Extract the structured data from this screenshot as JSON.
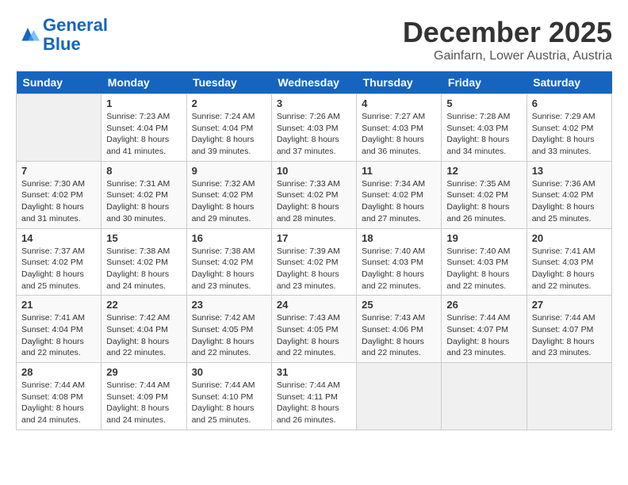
{
  "header": {
    "logo_line1": "General",
    "logo_line2": "Blue",
    "month_title": "December 2025",
    "location": "Gainfarn, Lower Austria, Austria"
  },
  "weekdays": [
    "Sunday",
    "Monday",
    "Tuesday",
    "Wednesday",
    "Thursday",
    "Friday",
    "Saturday"
  ],
  "weeks": [
    [
      {
        "day": "",
        "info": ""
      },
      {
        "day": "1",
        "info": "Sunrise: 7:23 AM\nSunset: 4:04 PM\nDaylight: 8 hours\nand 41 minutes."
      },
      {
        "day": "2",
        "info": "Sunrise: 7:24 AM\nSunset: 4:04 PM\nDaylight: 8 hours\nand 39 minutes."
      },
      {
        "day": "3",
        "info": "Sunrise: 7:26 AM\nSunset: 4:03 PM\nDaylight: 8 hours\nand 37 minutes."
      },
      {
        "day": "4",
        "info": "Sunrise: 7:27 AM\nSunset: 4:03 PM\nDaylight: 8 hours\nand 36 minutes."
      },
      {
        "day": "5",
        "info": "Sunrise: 7:28 AM\nSunset: 4:03 PM\nDaylight: 8 hours\nand 34 minutes."
      },
      {
        "day": "6",
        "info": "Sunrise: 7:29 AM\nSunset: 4:02 PM\nDaylight: 8 hours\nand 33 minutes."
      }
    ],
    [
      {
        "day": "7",
        "info": "Sunrise: 7:30 AM\nSunset: 4:02 PM\nDaylight: 8 hours\nand 31 minutes."
      },
      {
        "day": "8",
        "info": "Sunrise: 7:31 AM\nSunset: 4:02 PM\nDaylight: 8 hours\nand 30 minutes."
      },
      {
        "day": "9",
        "info": "Sunrise: 7:32 AM\nSunset: 4:02 PM\nDaylight: 8 hours\nand 29 minutes."
      },
      {
        "day": "10",
        "info": "Sunrise: 7:33 AM\nSunset: 4:02 PM\nDaylight: 8 hours\nand 28 minutes."
      },
      {
        "day": "11",
        "info": "Sunrise: 7:34 AM\nSunset: 4:02 PM\nDaylight: 8 hours\nand 27 minutes."
      },
      {
        "day": "12",
        "info": "Sunrise: 7:35 AM\nSunset: 4:02 PM\nDaylight: 8 hours\nand 26 minutes."
      },
      {
        "day": "13",
        "info": "Sunrise: 7:36 AM\nSunset: 4:02 PM\nDaylight: 8 hours\nand 25 minutes."
      }
    ],
    [
      {
        "day": "14",
        "info": "Sunrise: 7:37 AM\nSunset: 4:02 PM\nDaylight: 8 hours\nand 25 minutes."
      },
      {
        "day": "15",
        "info": "Sunrise: 7:38 AM\nSunset: 4:02 PM\nDaylight: 8 hours\nand 24 minutes."
      },
      {
        "day": "16",
        "info": "Sunrise: 7:38 AM\nSunset: 4:02 PM\nDaylight: 8 hours\nand 23 minutes."
      },
      {
        "day": "17",
        "info": "Sunrise: 7:39 AM\nSunset: 4:02 PM\nDaylight: 8 hours\nand 23 minutes."
      },
      {
        "day": "18",
        "info": "Sunrise: 7:40 AM\nSunset: 4:03 PM\nDaylight: 8 hours\nand 22 minutes."
      },
      {
        "day": "19",
        "info": "Sunrise: 7:40 AM\nSunset: 4:03 PM\nDaylight: 8 hours\nand 22 minutes."
      },
      {
        "day": "20",
        "info": "Sunrise: 7:41 AM\nSunset: 4:03 PM\nDaylight: 8 hours\nand 22 minutes."
      }
    ],
    [
      {
        "day": "21",
        "info": "Sunrise: 7:41 AM\nSunset: 4:04 PM\nDaylight: 8 hours\nand 22 minutes."
      },
      {
        "day": "22",
        "info": "Sunrise: 7:42 AM\nSunset: 4:04 PM\nDaylight: 8 hours\nand 22 minutes."
      },
      {
        "day": "23",
        "info": "Sunrise: 7:42 AM\nSunset: 4:05 PM\nDaylight: 8 hours\nand 22 minutes."
      },
      {
        "day": "24",
        "info": "Sunrise: 7:43 AM\nSunset: 4:05 PM\nDaylight: 8 hours\nand 22 minutes."
      },
      {
        "day": "25",
        "info": "Sunrise: 7:43 AM\nSunset: 4:06 PM\nDaylight: 8 hours\nand 22 minutes."
      },
      {
        "day": "26",
        "info": "Sunrise: 7:44 AM\nSunset: 4:07 PM\nDaylight: 8 hours\nand 23 minutes."
      },
      {
        "day": "27",
        "info": "Sunrise: 7:44 AM\nSunset: 4:07 PM\nDaylight: 8 hours\nand 23 minutes."
      }
    ],
    [
      {
        "day": "28",
        "info": "Sunrise: 7:44 AM\nSunset: 4:08 PM\nDaylight: 8 hours\nand 24 minutes."
      },
      {
        "day": "29",
        "info": "Sunrise: 7:44 AM\nSunset: 4:09 PM\nDaylight: 8 hours\nand 24 minutes."
      },
      {
        "day": "30",
        "info": "Sunrise: 7:44 AM\nSunset: 4:10 PM\nDaylight: 8 hours\nand 25 minutes."
      },
      {
        "day": "31",
        "info": "Sunrise: 7:44 AM\nSunset: 4:11 PM\nDaylight: 8 hours\nand 26 minutes."
      },
      {
        "day": "",
        "info": ""
      },
      {
        "day": "",
        "info": ""
      },
      {
        "day": "",
        "info": ""
      }
    ]
  ]
}
